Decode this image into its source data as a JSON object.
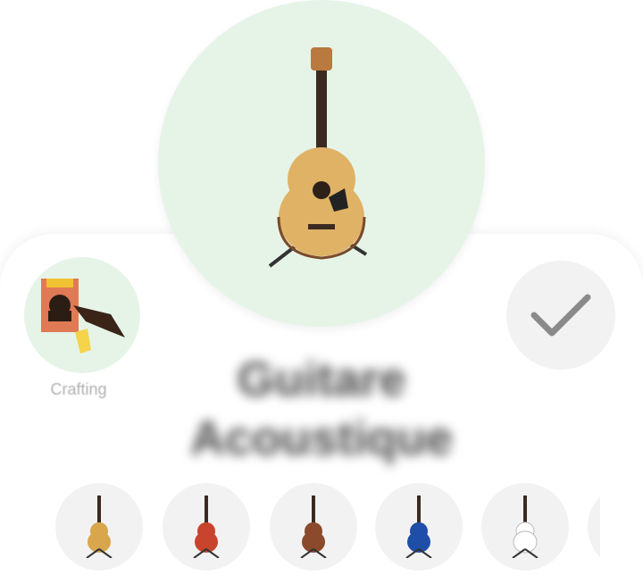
{
  "item": {
    "name": "Guitare Acoustique",
    "category_label": "Crafting",
    "image_icon": "acoustic-guitar-icon",
    "category_icon": "crafting-icon",
    "confirm_icon": "checkmark-icon"
  },
  "variants": [
    {
      "icon": "guitar-natural-icon",
      "color": "#d9a64e"
    },
    {
      "icon": "guitar-red-icon",
      "color": "#c8442c"
    },
    {
      "icon": "guitar-brown-icon",
      "color": "#8b4a2b"
    },
    {
      "icon": "guitar-blue-icon",
      "color": "#1f4ea8"
    },
    {
      "icon": "guitar-white-icon",
      "color": "#ececec"
    },
    {
      "icon": "guitar-partial-icon",
      "color": "#cfcfcf"
    }
  ],
  "colors": {
    "bubble_green": "#e6f4e8",
    "bubble_gray": "#f2f2f2",
    "check_gray": "#8a8a8a"
  }
}
